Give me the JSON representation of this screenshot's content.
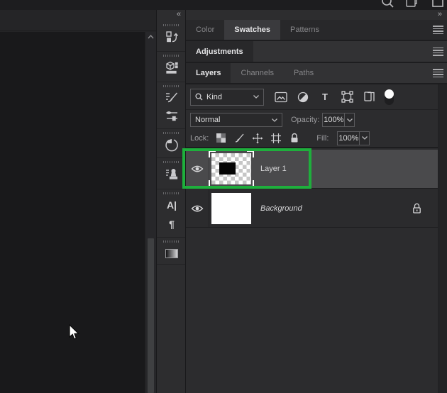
{
  "titlebar": {
    "icons": [
      "search-icon",
      "restore-window-icon",
      "maximize-icon"
    ]
  },
  "left_dock": {
    "collapse_glyph": "«",
    "panel_icons": [
      "layer-comps",
      "libraries",
      "brushes",
      "brush-settings",
      "history",
      "clone-source",
      "character",
      "paragraph",
      "gradients"
    ],
    "character_glyph": "A|",
    "paragraph_glyph": "¶"
  },
  "right_dock": {
    "expand_glyph": "»",
    "tab_groups": [
      {
        "tabs": [
          {
            "label": "Color",
            "active": false
          },
          {
            "label": "Swatches",
            "active": true
          },
          {
            "label": "Patterns",
            "active": false
          }
        ]
      },
      {
        "tabs": [
          {
            "label": "Adjustments",
            "active": true
          }
        ]
      },
      {
        "tabs": [
          {
            "label": "Layers",
            "active": true
          },
          {
            "label": "Channels",
            "active": false
          },
          {
            "label": "Paths",
            "active": false
          }
        ]
      }
    ],
    "layers_panel": {
      "filter": {
        "kind_label": "Kind",
        "type_glyph": "T",
        "toggle_on": true
      },
      "blend_mode": "Normal",
      "opacity_label": "Opacity:",
      "opacity_value": "100%",
      "lock_label": "Lock:",
      "fill_label": "Fill:",
      "fill_value": "100%",
      "layers": [
        {
          "name": "Layer 1",
          "selected": true,
          "visible": true,
          "thumbnail": "transparent-with-black-rectangle"
        },
        {
          "name": "Background",
          "selected": false,
          "visible": true,
          "locked": true,
          "thumbnail": "white"
        }
      ]
    }
  },
  "annotation": {
    "color": "#1eaf3c",
    "target": "Layer 1 row"
  },
  "colors": {
    "accent_green": "#1eaf3c",
    "selected_row": "#4a4a4c",
    "panel_bg": "#2c2c2e",
    "canvas_bg": "#19191b"
  }
}
